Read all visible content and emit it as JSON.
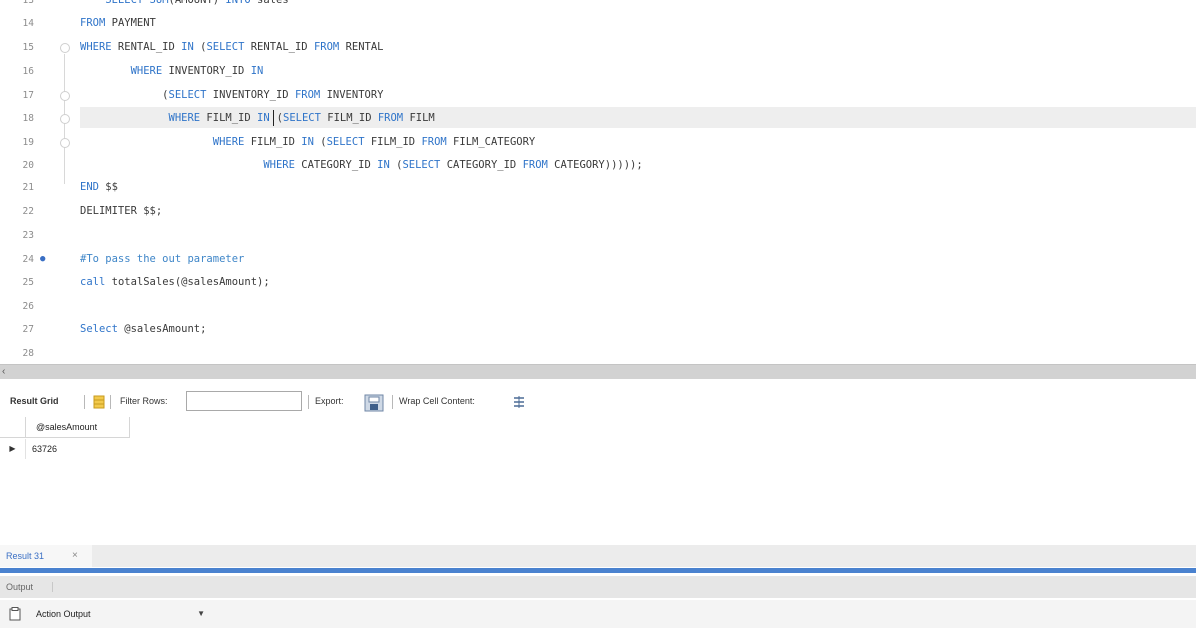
{
  "editor": {
    "lines": [
      {
        "num": "13",
        "marker": "",
        "fold": false,
        "segments": [
          {
            "t": "    SELECT ",
            "c": "kw"
          },
          {
            "t": "SUM",
            "c": "kw"
          },
          {
            "t": "(AMOUNT) ",
            "c": ""
          },
          {
            "t": "INTO",
            "c": "kw"
          },
          {
            "t": " sales",
            "c": ""
          }
        ]
      },
      {
        "num": "14",
        "marker": "",
        "fold": false,
        "segments": [
          {
            "t": "FROM",
            "c": "kw"
          },
          {
            "t": " PAYMENT",
            "c": ""
          }
        ]
      },
      {
        "num": "15",
        "marker": "",
        "fold": true,
        "segments": [
          {
            "t": "WHERE",
            "c": "kw"
          },
          {
            "t": " RENTAL_ID ",
            "c": ""
          },
          {
            "t": "IN",
            "c": "kw"
          },
          {
            "t": " (",
            "c": ""
          },
          {
            "t": "SELECT",
            "c": "kw"
          },
          {
            "t": " RENTAL_ID ",
            "c": ""
          },
          {
            "t": "FROM",
            "c": "kw"
          },
          {
            "t": " RENTAL",
            "c": ""
          }
        ]
      },
      {
        "num": "16",
        "marker": "",
        "fold": false,
        "segments": [
          {
            "t": "        WHERE",
            "c": "kw"
          },
          {
            "t": " INVENTORY_ID ",
            "c": ""
          },
          {
            "t": "IN",
            "c": "kw"
          }
        ]
      },
      {
        "num": "17",
        "marker": "",
        "fold": true,
        "segments": [
          {
            "t": "             (",
            "c": ""
          },
          {
            "t": "SELECT",
            "c": "kw"
          },
          {
            "t": " INVENTORY_ID ",
            "c": ""
          },
          {
            "t": "FROM",
            "c": "kw"
          },
          {
            "t": " INVENTORY",
            "c": ""
          }
        ]
      },
      {
        "num": "18",
        "marker": "",
        "fold": true,
        "current": true,
        "segments": [
          {
            "t": "              WHERE",
            "c": "kw"
          },
          {
            "t": " FILM_ID ",
            "c": ""
          },
          {
            "t": "IN",
            "c": "kw"
          },
          {
            "t": "CURSOR",
            "c": "cursor"
          },
          {
            "t": "(",
            "c": ""
          },
          {
            "t": "SELECT",
            "c": "kw"
          },
          {
            "t": " FILM_ID ",
            "c": ""
          },
          {
            "t": "FROM",
            "c": "kw"
          },
          {
            "t": " FILM",
            "c": ""
          }
        ]
      },
      {
        "num": "19",
        "marker": "",
        "fold": true,
        "segments": [
          {
            "t": "                     WHERE",
            "c": "kw"
          },
          {
            "t": " FILM_ID ",
            "c": ""
          },
          {
            "t": "IN",
            "c": "kw"
          },
          {
            "t": " (",
            "c": ""
          },
          {
            "t": "SELECT",
            "c": "kw"
          },
          {
            "t": " FILM_ID ",
            "c": ""
          },
          {
            "t": "FROM",
            "c": "kw"
          },
          {
            "t": " FILM_CATEGORY",
            "c": ""
          }
        ]
      },
      {
        "num": "20",
        "marker": "",
        "fold": false,
        "segments": [
          {
            "t": "                             WHERE",
            "c": "kw"
          },
          {
            "t": " CATEGORY_ID ",
            "c": ""
          },
          {
            "t": "IN",
            "c": "kw"
          },
          {
            "t": " (",
            "c": ""
          },
          {
            "t": "SELECT",
            "c": "kw"
          },
          {
            "t": " CATEGORY_ID ",
            "c": ""
          },
          {
            "t": "FROM",
            "c": "kw"
          },
          {
            "t": " CATEGORY)))));",
            "c": ""
          }
        ]
      },
      {
        "num": "21",
        "marker": "",
        "fold": false,
        "segments": [
          {
            "t": "END",
            "c": "kw"
          },
          {
            "t": " $$",
            "c": ""
          }
        ]
      },
      {
        "num": "22",
        "marker": "",
        "fold": false,
        "segments": [
          {
            "t": "DELIMITER $$;",
            "c": ""
          }
        ]
      },
      {
        "num": "23",
        "marker": "",
        "fold": false,
        "segments": []
      },
      {
        "num": "24",
        "marker": "●",
        "fold": false,
        "segments": [
          {
            "t": "#To pass the out parameter",
            "c": "cm"
          }
        ]
      },
      {
        "num": "25",
        "marker": "",
        "fold": false,
        "segments": [
          {
            "t": "call",
            "c": "kw"
          },
          {
            "t": " totalSales(@salesAmount);",
            "c": ""
          }
        ]
      },
      {
        "num": "26",
        "marker": "",
        "fold": false,
        "segments": []
      },
      {
        "num": "27",
        "marker": "",
        "fold": false,
        "segments": [
          {
            "t": "Select",
            "c": "kw"
          },
          {
            "t": " @salesAmount;",
            "c": ""
          }
        ]
      },
      {
        "num": "28",
        "marker": "",
        "fold": false,
        "segments": []
      }
    ]
  },
  "result_toolbar": {
    "result_grid_label": "Result Grid",
    "filter_rows_label": "Filter Rows:",
    "filter_value": "",
    "export_label": "Export:",
    "wrap_label": "Wrap Cell Content:"
  },
  "grid": {
    "columns": [
      "@salesAmount"
    ],
    "rows": [
      [
        "63726"
      ]
    ]
  },
  "result_tab": {
    "label": "Result 31",
    "close": "×"
  },
  "output": {
    "header": "Output",
    "select_value": "Action Output"
  },
  "icons": {
    "grid-icon": "yellow-grid",
    "export-icon": "save",
    "wrap-icon": "wrap-lines",
    "row-arrow-icon": "▶",
    "output-icon": "clipboard"
  }
}
